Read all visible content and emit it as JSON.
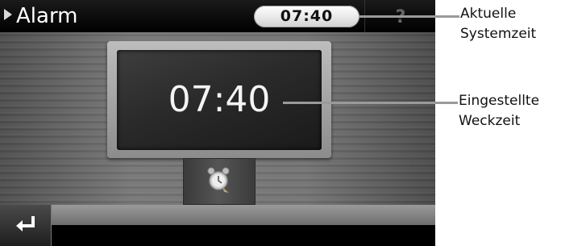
{
  "topbar": {
    "title": "Alarm",
    "current_time": "07:40",
    "help_label": "?"
  },
  "display": {
    "alarm_time": "07:40"
  },
  "callouts": {
    "system_time_line1": "Aktuelle",
    "system_time_line2": "Systemzeit",
    "alarm_time_line1": "Eingestellte",
    "alarm_time_line2": "Weckzeit"
  },
  "icons": {
    "title_arrow": "play-arrow-icon",
    "alarm_clock": "alarm-clock-icon",
    "back": "return-arrow-icon"
  }
}
